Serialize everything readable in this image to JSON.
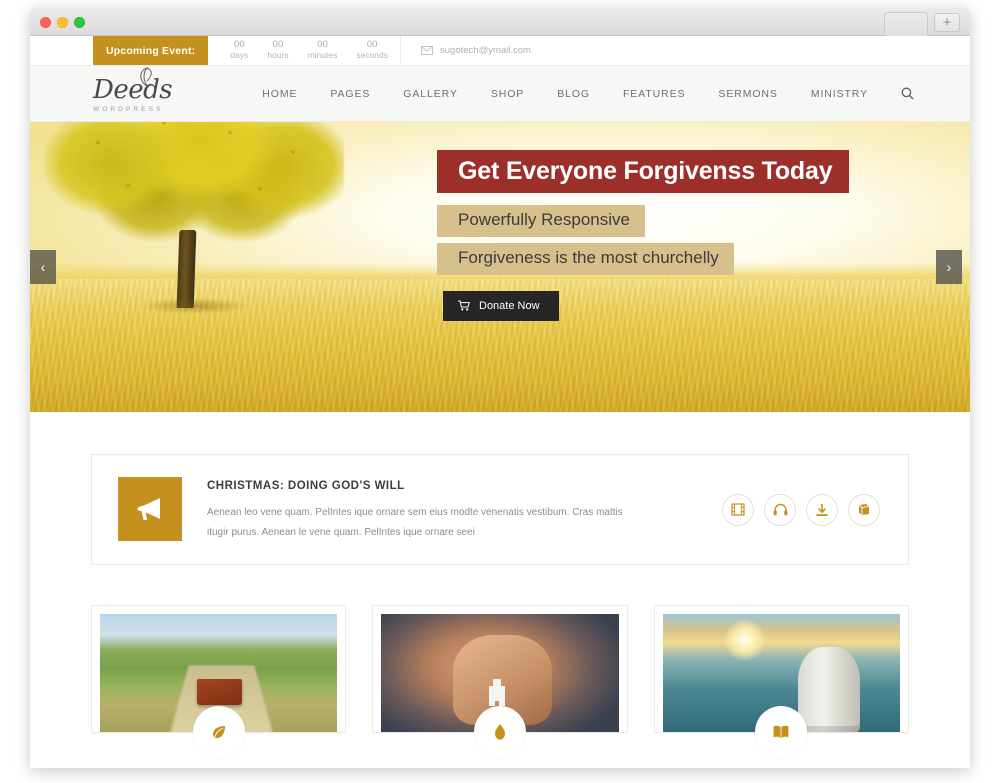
{
  "browser": {
    "new_tab_label": "+",
    "traffic_lights": [
      "close",
      "minimize",
      "maximize"
    ]
  },
  "topbar": {
    "upcoming_label": "Upcoming Event:",
    "countdown": [
      {
        "value": "00",
        "unit": "days"
      },
      {
        "value": "00",
        "unit": "hours"
      },
      {
        "value": "00",
        "unit": "minutes"
      },
      {
        "value": "00",
        "unit": "seconds"
      }
    ],
    "email": "sugotech@ymail.com"
  },
  "header": {
    "logo_word": "Deeds",
    "logo_sub": "WORDPRESS",
    "nav": [
      {
        "label": "HOME"
      },
      {
        "label": "PAGES"
      },
      {
        "label": "GALLERY"
      },
      {
        "label": "SHOP"
      },
      {
        "label": "BLOG"
      },
      {
        "label": "FEATURES"
      },
      {
        "label": "SERMONS"
      },
      {
        "label": "MINISTRY"
      }
    ]
  },
  "hero": {
    "title": "Get Everyone Forgivenss Today",
    "subtitle_1": "Powerfully Responsive",
    "subtitle_2": "Forgiveness is the most churchelly",
    "donate_label": "Donate Now",
    "prev_label": "‹",
    "next_label": "›",
    "title_bg": "#9d2f2b",
    "subtitle_bg": "#d8c08c",
    "button_bg": "#262626"
  },
  "sermon": {
    "title": "CHRISTMAS: DOING GOD'S WILL",
    "description": "Aenean leo vene quam. PelIntes ique ornare sem eius modte venenatis vestibum. Cras mattis itugir purus. Aenean le vene quam. PelIntes ique ornare seei",
    "icon_bg": "#c4911f",
    "actions": [
      {
        "name": "video"
      },
      {
        "name": "audio"
      },
      {
        "name": "download"
      },
      {
        "name": "notes"
      }
    ]
  },
  "cards": [
    {
      "image_alt": "leather bag on dirt road through green field",
      "badge_icon": "leaf"
    },
    {
      "image_alt": "praying hands holding rosary with cross",
      "badge_icon": "flame"
    },
    {
      "image_alt": "lighthouse at sunset over the sea",
      "badge_icon": "book"
    }
  ],
  "colors": {
    "brand_gold": "#c4911f",
    "hero_red": "#9d2f2b",
    "header_bg": "#f7f7f5"
  }
}
